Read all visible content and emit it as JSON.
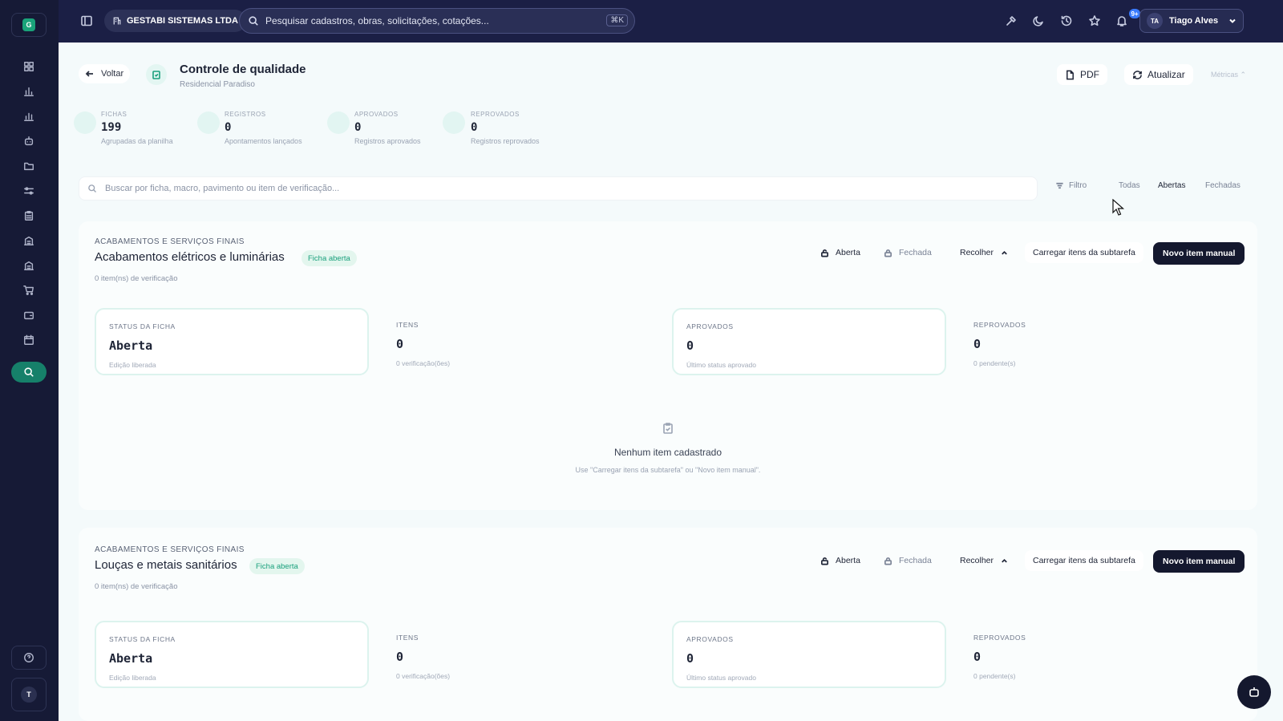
{
  "sidebar": {
    "logo": "G",
    "icons": [
      "dashboard-icon",
      "bar-chart-icon",
      "analytics-icon",
      "robot-icon",
      "folder-icon",
      "sliders-icon",
      "clipboard-icon",
      "building-icon",
      "building-alt-icon",
      "cart-icon",
      "wallet-icon",
      "calendar-icon",
      "quality-search-icon"
    ],
    "help_icon": "help-icon",
    "avatar": "T"
  },
  "topbar": {
    "company": "GESTABI SISTEMAS LTDA",
    "search_placeholder": "Pesquisar cadastros, obras, solicitações, cotações...",
    "shortcut": "⌘K",
    "notifications_badge": "9+",
    "user_initials": "TA",
    "user_name": "Tiago Alves"
  },
  "header": {
    "back_label": "Voltar",
    "title": "Controle de qualidade",
    "subtitle": "Residencial Paradiso",
    "pdf_label": "PDF",
    "update_label": "Atualizar",
    "metrics_label": "Métricas"
  },
  "summary": [
    {
      "label": "FICHAS",
      "value": "199",
      "sub": "Agrupadas da planilha"
    },
    {
      "label": "REGISTROS",
      "value": "0",
      "sub": "Apontamentos lançados"
    },
    {
      "label": "APROVADOS",
      "value": "0",
      "sub": "Registros aprovados"
    },
    {
      "label": "REPROVADOS",
      "value": "0",
      "sub": "Registros reprovados"
    }
  ],
  "filters": {
    "search_placeholder": "Buscar por ficha, macro, pavimento ou item de verificação...",
    "filter_label": "Filtro",
    "segments": [
      "Todas",
      "Abertas",
      "Fechadas"
    ],
    "active_segment": "Abertas"
  },
  "sections": [
    {
      "category": "ACABAMENTOS E SERVIÇOS FINAIS",
      "title": "Acabamentos elétricos e luminárias",
      "badge": "Ficha aberta",
      "count": "0 item(ns) de verificação",
      "opt_open": "Aberta",
      "opt_closed": "Fechada",
      "collapse": "Recolher",
      "load_label": "Carregar itens da subtarefa",
      "new_label": "Novo item manual",
      "cards": [
        {
          "label": "STATUS DA FICHA",
          "value": "Aberta",
          "sub": "Edição liberada"
        },
        {
          "label": "ITENS",
          "value": "0",
          "sub": "0 verificação(ões)"
        },
        {
          "label": "APROVADOS",
          "value": "0",
          "sub": "Último status aprovado"
        },
        {
          "label": "REPROVADOS",
          "value": "0",
          "sub": "0 pendente(s)"
        }
      ],
      "empty_title": "Nenhum item cadastrado",
      "empty_sub": "Use \"Carregar itens da subtarefa\" ou \"Novo item manual\"."
    },
    {
      "category": "ACABAMENTOS E SERVIÇOS FINAIS",
      "title": "Louças e metais sanitários",
      "badge": "Ficha aberta",
      "count": "0 item(ns) de verificação",
      "opt_open": "Aberta",
      "opt_closed": "Fechada",
      "collapse": "Recolher",
      "load_label": "Carregar itens da subtarefa",
      "new_label": "Novo item manual",
      "cards": [
        {
          "label": "STATUS DA FICHA",
          "value": "Aberta",
          "sub": "Edição liberada"
        },
        {
          "label": "ITENS",
          "value": "0",
          "sub": "0 verificação(ões)"
        },
        {
          "label": "APROVADOS",
          "value": "0",
          "sub": "Último status aprovado"
        },
        {
          "label": "REPROVADOS",
          "value": "0",
          "sub": "0 pendente(s)"
        }
      ]
    }
  ],
  "colors": {
    "sidebar_bg": "#161a36",
    "topbar_bg": "#1b1f45",
    "accent": "#19a07c",
    "primary_button": "#14182e"
  }
}
